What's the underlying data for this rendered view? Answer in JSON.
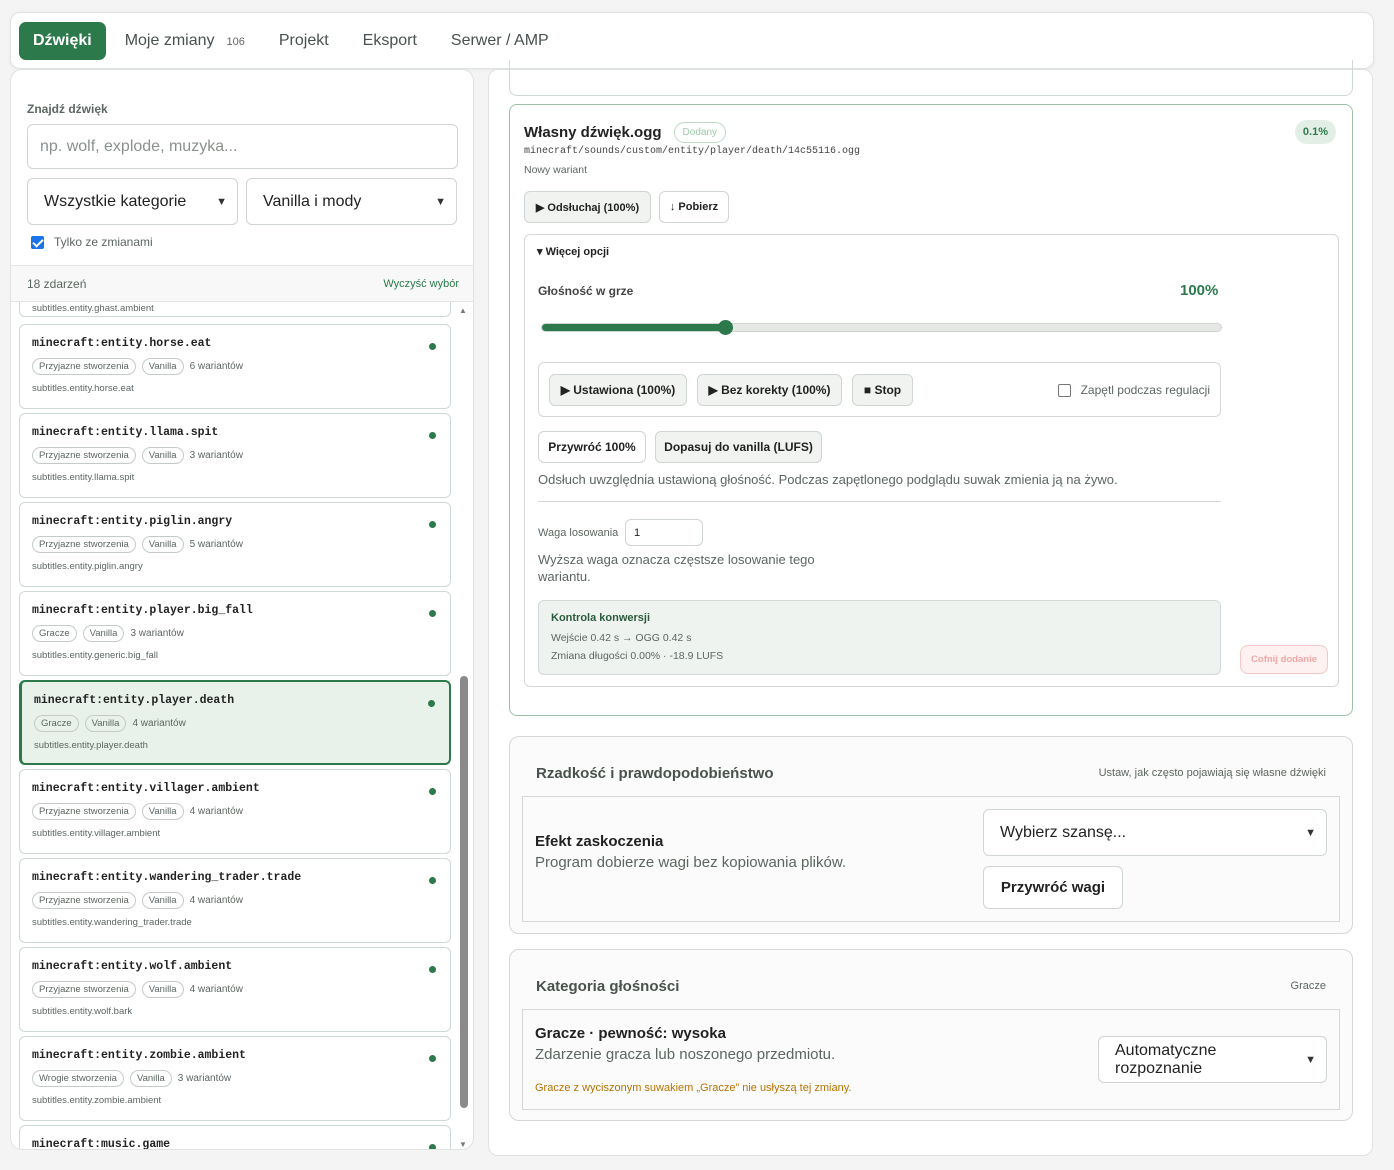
{
  "nav": {
    "tabs": [
      {
        "label": "Dźwięki",
        "active": true
      },
      {
        "label": "Moje zmiany",
        "count": "106"
      },
      {
        "label": "Projekt"
      },
      {
        "label": "Eksport"
      },
      {
        "label": "Serwer / AMP"
      }
    ]
  },
  "sidebar": {
    "search_label": "Znajdź dźwięk",
    "search_placeholder": "np. wolf, explode, muzyka...",
    "category_select": "Wszystkie kategorie",
    "source_select": "Vanilla i mody",
    "only_changes_label": "Tylko ze zmianami",
    "only_changes_checked": true,
    "event_count": "18 zdarzeń",
    "clear_label": "Wyczyść wybór",
    "partial_top_subtitle": "subtitles.entity.ghast.ambient",
    "items": [
      {
        "name": "minecraft:entity.horse.eat",
        "tags": [
          "Przyjazne stworzenia",
          "Vanilla"
        ],
        "variants": "6 wariantów",
        "subtitle": "subtitles.entity.horse.eat"
      },
      {
        "name": "minecraft:entity.llama.spit",
        "tags": [
          "Przyjazne stworzenia",
          "Vanilla"
        ],
        "variants": "3 wariantów",
        "subtitle": "subtitles.entity.llama.spit"
      },
      {
        "name": "minecraft:entity.piglin.angry",
        "tags": [
          "Przyjazne stworzenia",
          "Vanilla"
        ],
        "variants": "5 wariantów",
        "subtitle": "subtitles.entity.piglin.angry"
      },
      {
        "name": "minecraft:entity.player.big_fall",
        "tags": [
          "Gracze",
          "Vanilla"
        ],
        "variants": "3 wariantów",
        "subtitle": "subtitles.entity.generic.big_fall"
      },
      {
        "name": "minecraft:entity.player.death",
        "tags": [
          "Gracze",
          "Vanilla"
        ],
        "variants": "4 wariantów",
        "subtitle": "subtitles.entity.player.death",
        "selected": true
      },
      {
        "name": "minecraft:entity.villager.ambient",
        "tags": [
          "Przyjazne stworzenia",
          "Vanilla"
        ],
        "variants": "4 wariantów",
        "subtitle": "subtitles.entity.villager.ambient"
      },
      {
        "name": "minecraft:entity.wandering_trader.trade",
        "tags": [
          "Przyjazne stworzenia",
          "Vanilla"
        ],
        "variants": "4 wariantów",
        "subtitle": "subtitles.entity.wandering_trader.trade"
      },
      {
        "name": "minecraft:entity.wolf.ambient",
        "tags": [
          "Przyjazne stworzenia",
          "Vanilla"
        ],
        "variants": "4 wariantów",
        "subtitle": "subtitles.entity.wolf.bark"
      },
      {
        "name": "minecraft:entity.zombie.ambient",
        "tags": [
          "Wrogie stworzenia",
          "Vanilla"
        ],
        "variants": "3 wariantów",
        "subtitle": "subtitles.entity.zombie.ambient"
      },
      {
        "name": "minecraft:music.game",
        "tags": [],
        "variants": "",
        "subtitle": ""
      }
    ]
  },
  "variant": {
    "title": "Własny dźwięk.ogg",
    "status_badge": "Dodany",
    "percent_badge": "0.1%",
    "path": "minecraft/sounds/custom/entity/player/death/14c55116.ogg",
    "subtitle": "Nowy wariant",
    "listen_button": "▶ Odsłuchaj (100%)",
    "download_button": "↓ Pobierz",
    "more_options": "▾ Więcej opcji",
    "volume_label": "Głośność w grze",
    "volume_value": "100%",
    "volume_level": 0.27,
    "play_set_button": "▶ Ustawiona (100%)",
    "play_raw_button": "▶ Bez korekty (100%)",
    "stop_button": "■ Stop",
    "loop_label": "Zapętl podczas regulacji",
    "loop_checked": false,
    "restore_button": "Przywróć 100%",
    "match_button": "Dopasuj do vanilla (LUFS)",
    "hint": "Odsłuch uwzględnia ustawioną głośność. Podczas zapętlonego podglądu suwak zmienia ją na żywo.",
    "weight_label": "Waga losowania",
    "weight_value": "1",
    "weight_help": "Wyższa waga oznacza częstsze losowanie tego wariantu.",
    "conversion_title": "Kontrola konwersji",
    "conversion_line1": "Wejście 0.42 s → OGG 0.42 s",
    "conversion_line2": "Zmiana długości 0.00% · -18.9 LUFS",
    "undo_button": "Cofnij dodanie"
  },
  "rarity": {
    "title": "Rzadkość i prawdopodobieństwo",
    "hint": "Ustaw, jak często pojawiają się własne dźwięki",
    "effect_title": "Efekt zaskoczenia",
    "effect_desc": "Program dobierze wagi bez kopiowania plików.",
    "chance_select": "Wybierz szansę...",
    "restore_weights": "Przywróć wagi"
  },
  "category": {
    "title": "Kategoria głośności",
    "current": "Gracze",
    "detected_title": "Gracze · pewność: wysoka",
    "detected_desc": "Zdarzenie gracza lub noszonego przedmiotu.",
    "warning": "Gracze z wyciszonym suwakiem „Gracze” nie usłyszą tej zmiany.",
    "mode_select": "Automatyczne rozpoznanie"
  }
}
